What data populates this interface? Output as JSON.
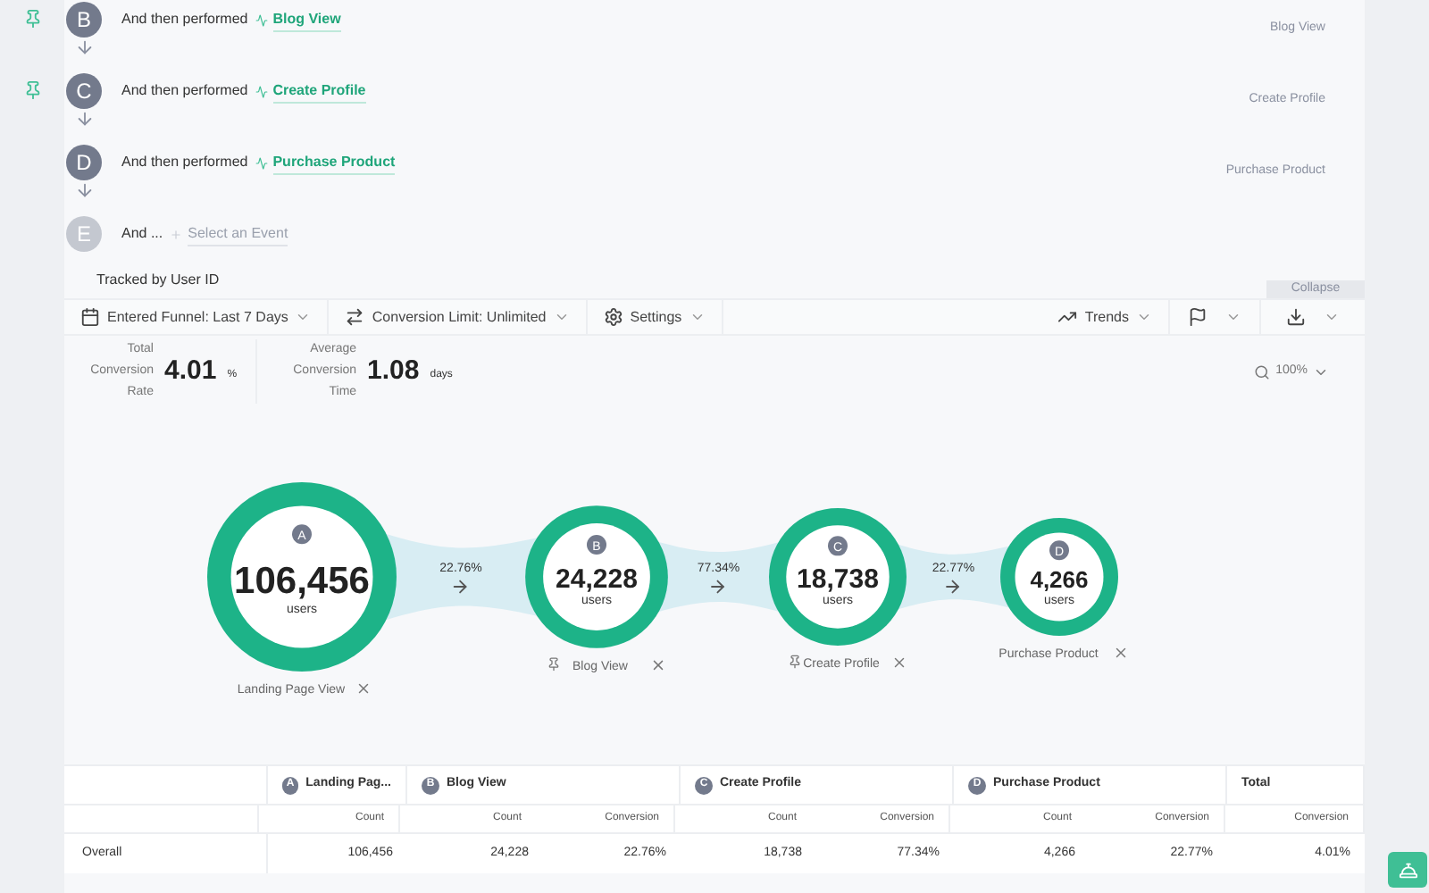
{
  "steps": [
    {
      "letter": "B",
      "pinned": true,
      "disabled": false,
      "prefix": "And then performed",
      "event": "Blog View",
      "right_label": "Blog View"
    },
    {
      "letter": "C",
      "pinned": true,
      "disabled": false,
      "prefix": "And then performed",
      "event": "Create Profile",
      "right_label": "Create Profile"
    },
    {
      "letter": "D",
      "pinned": false,
      "disabled": false,
      "prefix": "And then performed",
      "event": "Purchase Product",
      "right_label": "Purchase Product"
    },
    {
      "letter": "E",
      "pinned": false,
      "disabled": true,
      "prefix": "And ...",
      "event": "Select an Event"
    }
  ],
  "tracked_by": "Tracked by User ID",
  "collapse": "Collapse",
  "toolbar": {
    "left": [
      {
        "kind": "calendar",
        "label": "Entered Funnel: Last 7 Days"
      },
      {
        "kind": "limit",
        "label": "Conversion Limit: Unlimited"
      },
      {
        "kind": "settings",
        "label": "Settings"
      }
    ],
    "trends": "Trends"
  },
  "stats": [
    {
      "label": "Total Conversion Rate",
      "value": "4.01",
      "unit": "%"
    },
    {
      "label": "Average Conversion Time",
      "value": "1.08",
      "unit": "days"
    }
  ],
  "zoom": "100%",
  "funnel": [
    {
      "letter": "A",
      "count": "106,456",
      "unit": "users",
      "name": "Landing Page View",
      "pinned": false,
      "rate": "22.76%"
    },
    {
      "letter": "B",
      "count": "24,228",
      "unit": "users",
      "name": "Blog View",
      "pinned": true,
      "rate": "77.34%"
    },
    {
      "letter": "C",
      "count": "18,738",
      "unit": "users",
      "name": "Create Profile",
      "pinned": true,
      "rate": "22.77%"
    },
    {
      "letter": "D",
      "count": "4,266",
      "unit": "users",
      "name": "Purchase Product",
      "pinned": false
    }
  ],
  "table": {
    "groups": [
      {
        "letter": "A",
        "title": "Landing Pag...",
        "columns": [
          "Count"
        ]
      },
      {
        "letter": "B",
        "title": "Blog View",
        "columns": [
          "Count",
          "Conversion"
        ]
      },
      {
        "letter": "C",
        "title": "Create Profile",
        "columns": [
          "Count",
          "Conversion"
        ]
      },
      {
        "letter": "D",
        "title": "Purchase Product",
        "columns": [
          "Count",
          "Conversion"
        ]
      },
      {
        "title": "Total",
        "columns": [
          "Conversion"
        ]
      }
    ],
    "rows": [
      {
        "label": "Overall",
        "cells": [
          "106,456",
          "24,228",
          "22.76%",
          "18,738",
          "77.34%",
          "4,266",
          "22.77%",
          "4.01%"
        ]
      }
    ]
  }
}
